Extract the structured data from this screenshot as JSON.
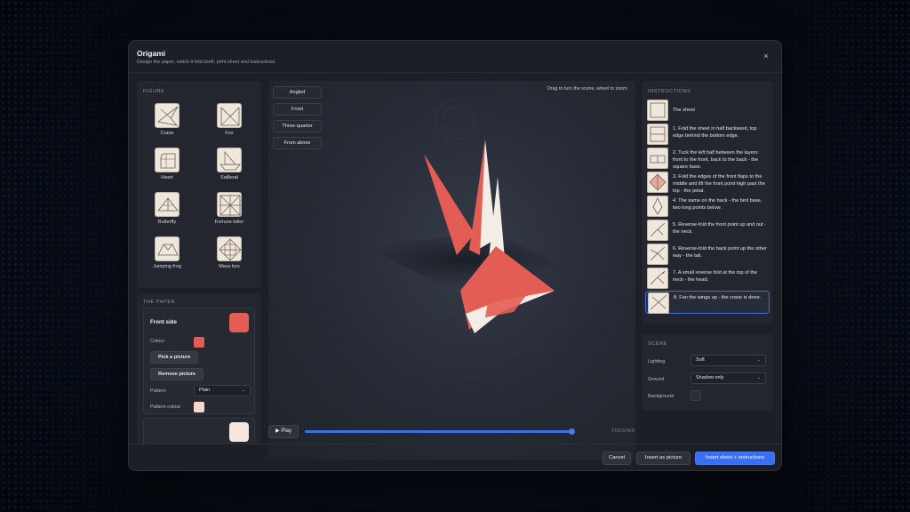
{
  "dialog": {
    "title": "Origami",
    "subtitle": "Design the paper, watch it fold itself, print sheet and instructions.",
    "close_label": "×"
  },
  "figure": {
    "section_label": "FIGURE",
    "items": [
      {
        "name": "Crane",
        "selected": true,
        "icon": "crane-icon"
      },
      {
        "name": "Fox",
        "selected": false,
        "icon": "fox-icon"
      },
      {
        "name": "Heart",
        "selected": false,
        "icon": "heart-icon"
      },
      {
        "name": "Sailboat",
        "selected": false,
        "icon": "sailboat-icon"
      },
      {
        "name": "Butterfly",
        "selected": false,
        "icon": "butterfly-icon"
      },
      {
        "name": "Fortune teller",
        "selected": false,
        "icon": "fortune-teller-icon"
      },
      {
        "name": "Jumping frog",
        "selected": false,
        "icon": "jumping-frog-icon"
      },
      {
        "name": "Masu box",
        "selected": false,
        "icon": "masu-box-icon"
      }
    ]
  },
  "paper": {
    "section_label": "THE PAPER",
    "front_title": "Front side",
    "front_color": "#e35d54",
    "colour_label": "Colour",
    "pick_picture": "Pick a picture",
    "remove_picture": "Remove picture",
    "pattern_label": "Pattern",
    "pattern_value": "Plain",
    "pattern_colour_label": "Pattern colour",
    "pattern_color": "#f6d9cd",
    "back_color": "#f6e6dd"
  },
  "viewport": {
    "views": [
      "Angled",
      "Front",
      "Three-quarter",
      "From above"
    ],
    "hint": "Drag to turn the scene, wheel to zoom.",
    "paper_color": "#e35d54",
    "paper_back_color": "#f4ece6"
  },
  "timeline": {
    "play_label": "▶ Play",
    "progress": 1.0,
    "step_readout": "FINISHED"
  },
  "instructions": {
    "section_label": "INSTRUCTIONS",
    "active_index": 8,
    "steps": [
      "The sheet",
      "1. Fold the sheet in half backward, top edge behind the bottom edge.",
      "2. Tuck the left half between the layers: front to the front, back to the back - the square base.",
      "3. Fold the edges of the front flaps to the middle and lift the front point high past the top - the petal.",
      "4. The same on the back - the bird base, two long points below.",
      "5. Reverse-fold the front point up and out - the neck.",
      "6. Reverse-fold the back point up the other way - the tail.",
      "7. A small reverse fold at the top of the neck - the head.",
      "8. Fan the wings up - the crane is done."
    ]
  },
  "scene": {
    "section_label": "SCENE",
    "lighting_label": "Lighting",
    "lighting_value": "Soft",
    "ground_label": "Ground",
    "ground_value": "Shadow only",
    "background_label": "Background",
    "background_color": "#2a2d34"
  },
  "footer": {
    "cancel": "Cancel",
    "insert_picture": "Insert as picture",
    "insert_sheet": "Insert sheet + instructions"
  },
  "colors": {
    "accent": "#3d6fe0",
    "paper_tan": "#efe6dc"
  }
}
